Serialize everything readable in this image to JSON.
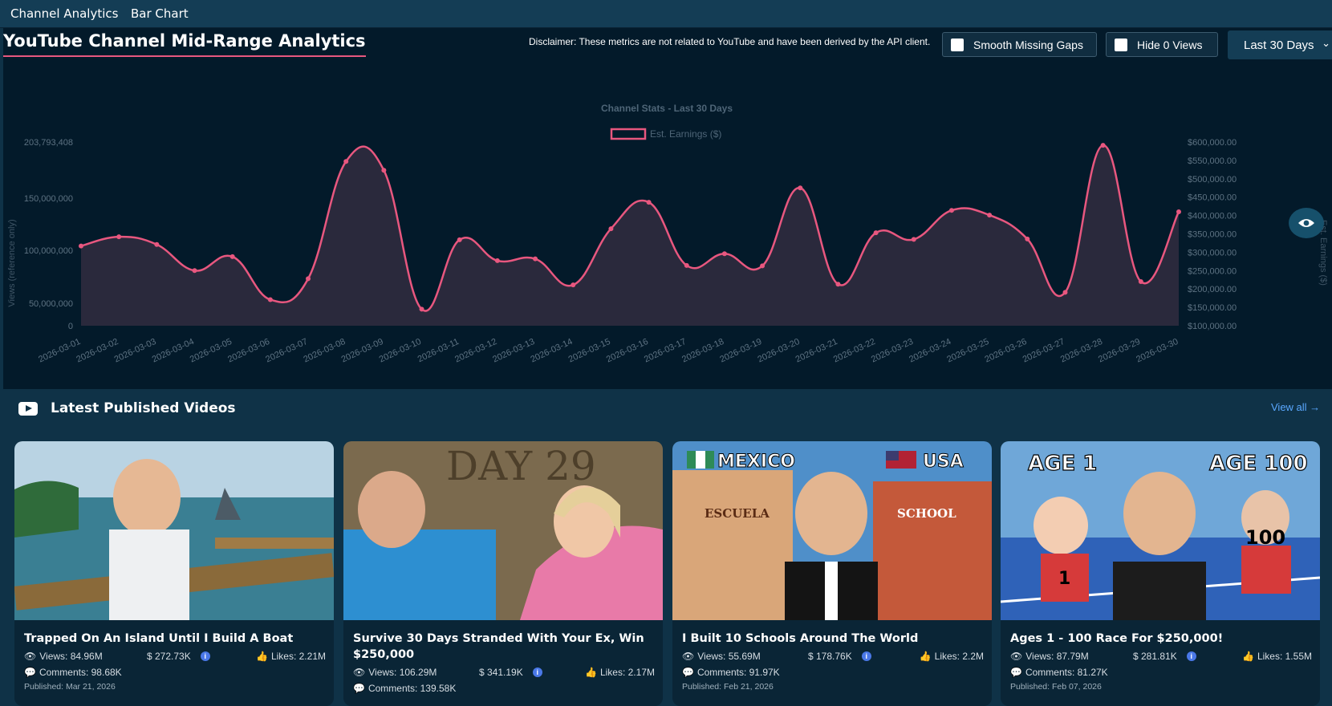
{
  "nav": {
    "links": [
      "Channel Analytics",
      "Bar Chart"
    ]
  },
  "header": {
    "title": "YouTube Channel Mid-Range Analytics",
    "disclaimer": "Disclaimer: These metrics are not related to YouTube and have been derived by the API client.",
    "toggle_smooth": "Smooth Missing Gaps",
    "toggle_hide_zero": "Hide 0 Views",
    "range_select": "Last 30 Days"
  },
  "chart_data": {
    "type": "area",
    "title": "Channel Stats - Last 30 Days",
    "ylabel": "Views (reference only)",
    "y2label": "Est. Earnings ($)",
    "y_ticks": [
      "203,793,408",
      "150,000,000",
      "100,000,000",
      "50,000,000",
      "0"
    ],
    "y2_ticks": [
      "$600,000.00",
      "$550,000.00",
      "$500,000.00",
      "$450,000.00",
      "$400,000.00",
      "$350,000.00",
      "$300,000.00",
      "$250,000.00",
      "$200,000.00",
      "$150,000.00",
      "$100,000.00"
    ],
    "y2lim": [
      100000,
      600000
    ],
    "x": [
      "2026-03-01",
      "2026-03-02",
      "2026-03-03",
      "2026-03-04",
      "2026-03-05",
      "2026-03-06",
      "2026-03-07",
      "2026-03-08",
      "2026-03-09",
      "2026-03-10",
      "2026-03-11",
      "2026-03-12",
      "2026-03-13",
      "2026-03-14",
      "2026-03-15",
      "2026-03-16",
      "2026-03-17",
      "2026-03-18",
      "2026-03-19",
      "2026-03-20",
      "2026-03-21",
      "2026-03-22",
      "2026-03-23",
      "2026-03-24",
      "2026-03-25",
      "2026-03-26",
      "2026-03-27",
      "2026-03-28",
      "2026-03-29",
      "2026-03-30"
    ],
    "series": [
      {
        "name": "Est. Earnings ($)",
        "color": "#e8577f",
        "values": [
          317000,
          342000,
          321000,
          250000,
          288000,
          171000,
          228000,
          547000,
          523000,
          145000,
          334000,
          277000,
          282000,
          211000,
          364000,
          436000,
          264000,
          296000,
          263000,
          475000,
          213000,
          353000,
          335000,
          414000,
          401000,
          336000,
          191000,
          591000,
          220000,
          410000
        ]
      }
    ],
    "legend": "top-center",
    "grid": false
  },
  "videos": {
    "section_title": "Latest Published Videos",
    "view_all": "View all →",
    "items": [
      {
        "title": "Trapped On An Island Until I Build A Boat",
        "views": "Views: 84.96M",
        "earnings": "$ 272.73K",
        "likes": "Likes: 2.21M",
        "comments": "Comments: 98.68K",
        "published": "Published: Mar 21, 2026"
      },
      {
        "title": "Survive 30 Days Stranded With Your Ex, Win $250,000",
        "views": "Views: 106.29M",
        "earnings": "$ 341.19K",
        "likes": "Likes: 2.17M",
        "comments": "Comments: 139.58K",
        "published": ""
      },
      {
        "title": "I Built 10 Schools Around The World",
        "views": "Views: 55.69M",
        "earnings": "$ 178.76K",
        "likes": "Likes: 2.2M",
        "comments": "Comments: 91.97K",
        "published": "Published: Feb 21, 2026"
      },
      {
        "title": "Ages 1 - 100 Race For $250,000!",
        "views": "Views: 87.79M",
        "earnings": "$ 281.81K",
        "likes": "Likes: 1.55M",
        "comments": "Comments: 81.27K",
        "published": "Published: Feb 07, 2026"
      }
    ],
    "thumb_text": {
      "day": "DAY 29",
      "mexico": "MEXICO",
      "usa": "USA",
      "escuela": "ESCUELA",
      "school": "SCHOOL",
      "age1": "AGE 1",
      "age100": "AGE 100",
      "bib1": "1",
      "bib100": "100"
    }
  },
  "colors": {
    "accent": "#e8577f",
    "link": "#5aa8ff",
    "panel": "#031a2a",
    "page": "#0f3247"
  }
}
